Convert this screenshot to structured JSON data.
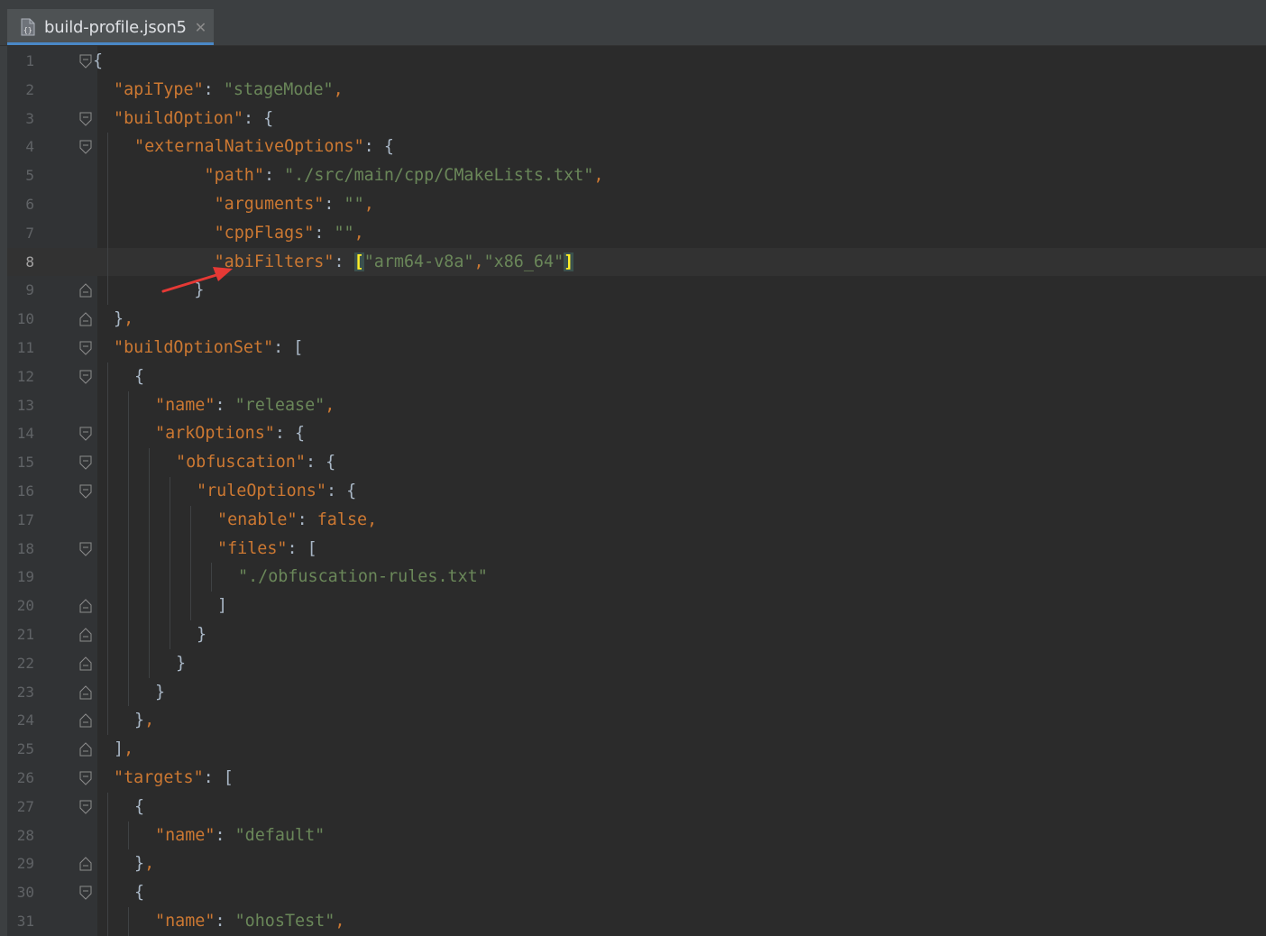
{
  "editor": {
    "tab": {
      "icon": "json-file-icon",
      "name": "build-profile.json5",
      "close_icon": "close-icon"
    }
  },
  "lines": [
    {
      "num": "1",
      "indent": 0,
      "fold": "open",
      "tokens": [
        {
          "t": "{",
          "c": "p"
        }
      ]
    },
    {
      "num": "2",
      "indent": 1,
      "fold": "",
      "tokens": [
        {
          "t": "\"apiType\"",
          "c": "k"
        },
        {
          "t": ": ",
          "c": "p"
        },
        {
          "t": "\"stageMode\"",
          "c": "s"
        },
        {
          "t": ",",
          "c": "o"
        }
      ]
    },
    {
      "num": "3",
      "indent": 1,
      "fold": "open",
      "tokens": [
        {
          "t": "\"buildOption\"",
          "c": "k"
        },
        {
          "t": ": {",
          "c": "p"
        }
      ]
    },
    {
      "num": "4",
      "indent": 2,
      "fold": "open",
      "tokens": [
        {
          "t": "\"externalNativeOptions\"",
          "c": "k"
        },
        {
          "t": ": {",
          "c": "p"
        }
      ]
    },
    {
      "num": "5",
      "indent": 2,
      "fold": "",
      "tokens": [
        {
          "t": "       ",
          "c": "p"
        },
        {
          "t": "\"path\"",
          "c": "k"
        },
        {
          "t": ": ",
          "c": "p"
        },
        {
          "t": "\"./src/main/cpp/CMakeLists.txt\"",
          "c": "s"
        },
        {
          "t": ",",
          "c": "o"
        }
      ]
    },
    {
      "num": "6",
      "indent": 2,
      "fold": "",
      "tokens": [
        {
          "t": "        ",
          "c": "p"
        },
        {
          "t": "\"arguments\"",
          "c": "k"
        },
        {
          "t": ": ",
          "c": "p"
        },
        {
          "t": "\"\"",
          "c": "s"
        },
        {
          "t": ",",
          "c": "o"
        }
      ]
    },
    {
      "num": "7",
      "indent": 2,
      "fold": "",
      "tokens": [
        {
          "t": "        ",
          "c": "p"
        },
        {
          "t": "\"cppFlags\"",
          "c": "k"
        },
        {
          "t": ": ",
          "c": "p"
        },
        {
          "t": "\"\"",
          "c": "s"
        },
        {
          "t": ",",
          "c": "o"
        }
      ]
    },
    {
      "num": "8",
      "indent": 2,
      "fold": "",
      "current": true,
      "tokens": [
        {
          "t": "        ",
          "c": "p"
        },
        {
          "t": "\"abiFilters\"",
          "c": "k"
        },
        {
          "t": ": ",
          "c": "p"
        },
        {
          "t": "[",
          "c": "b"
        },
        {
          "t": "\"arm64-v8a\"",
          "c": "s"
        },
        {
          "t": ",",
          "c": "o"
        },
        {
          "t": "\"x86_64\"",
          "c": "s"
        },
        {
          "t": "]",
          "c": "b"
        }
      ]
    },
    {
      "num": "9",
      "indent": 2,
      "fold": "close",
      "tokens": [
        {
          "t": "      }",
          "c": "p"
        }
      ]
    },
    {
      "num": "10",
      "indent": 1,
      "fold": "close",
      "tokens": [
        {
          "t": "}",
          "c": "p"
        },
        {
          "t": ",",
          "c": "o"
        }
      ]
    },
    {
      "num": "11",
      "indent": 1,
      "fold": "open",
      "tokens": [
        {
          "t": "\"buildOptionSet\"",
          "c": "k"
        },
        {
          "t": ": [",
          "c": "p"
        }
      ]
    },
    {
      "num": "12",
      "indent": 2,
      "fold": "open",
      "tokens": [
        {
          "t": "{",
          "c": "p"
        }
      ]
    },
    {
      "num": "13",
      "indent": 3,
      "fold": "",
      "tokens": [
        {
          "t": "\"name\"",
          "c": "k"
        },
        {
          "t": ": ",
          "c": "p"
        },
        {
          "t": "\"release\"",
          "c": "s"
        },
        {
          "t": ",",
          "c": "o"
        }
      ]
    },
    {
      "num": "14",
      "indent": 3,
      "fold": "open",
      "tokens": [
        {
          "t": "\"arkOptions\"",
          "c": "k"
        },
        {
          "t": ": {",
          "c": "p"
        }
      ]
    },
    {
      "num": "15",
      "indent": 4,
      "fold": "open",
      "tokens": [
        {
          "t": "\"obfuscation\"",
          "c": "k"
        },
        {
          "t": ": {",
          "c": "p"
        }
      ]
    },
    {
      "num": "16",
      "indent": 5,
      "fold": "open",
      "tokens": [
        {
          "t": "\"ruleOptions\"",
          "c": "k"
        },
        {
          "t": ": {",
          "c": "p"
        }
      ]
    },
    {
      "num": "17",
      "indent": 6,
      "fold": "",
      "tokens": [
        {
          "t": "\"enable\"",
          "c": "k"
        },
        {
          "t": ": ",
          "c": "p"
        },
        {
          "t": "false",
          "c": "o"
        },
        {
          "t": ",",
          "c": "o"
        }
      ]
    },
    {
      "num": "18",
      "indent": 6,
      "fold": "open",
      "tokens": [
        {
          "t": "\"files\"",
          "c": "k"
        },
        {
          "t": ": [",
          "c": "p"
        }
      ]
    },
    {
      "num": "19",
      "indent": 7,
      "fold": "",
      "tokens": [
        {
          "t": "\"./obfuscation-rules.txt\"",
          "c": "s"
        }
      ]
    },
    {
      "num": "20",
      "indent": 6,
      "fold": "close",
      "tokens": [
        {
          "t": "]",
          "c": "p"
        }
      ]
    },
    {
      "num": "21",
      "indent": 5,
      "fold": "close",
      "tokens": [
        {
          "t": "}",
          "c": "p"
        }
      ]
    },
    {
      "num": "22",
      "indent": 4,
      "fold": "close",
      "tokens": [
        {
          "t": "}",
          "c": "p"
        }
      ]
    },
    {
      "num": "23",
      "indent": 3,
      "fold": "close",
      "tokens": [
        {
          "t": "}",
          "c": "p"
        }
      ]
    },
    {
      "num": "24",
      "indent": 2,
      "fold": "close",
      "tokens": [
        {
          "t": "}",
          "c": "p"
        },
        {
          "t": ",",
          "c": "o"
        }
      ]
    },
    {
      "num": "25",
      "indent": 1,
      "fold": "close",
      "tokens": [
        {
          "t": "]",
          "c": "p"
        },
        {
          "t": ",",
          "c": "o"
        }
      ]
    },
    {
      "num": "26",
      "indent": 1,
      "fold": "open",
      "tokens": [
        {
          "t": "\"targets\"",
          "c": "k"
        },
        {
          "t": ": [",
          "c": "p"
        }
      ]
    },
    {
      "num": "27",
      "indent": 2,
      "fold": "open",
      "tokens": [
        {
          "t": "{",
          "c": "p"
        }
      ]
    },
    {
      "num": "28",
      "indent": 3,
      "fold": "",
      "tokens": [
        {
          "t": "\"name\"",
          "c": "k"
        },
        {
          "t": ": ",
          "c": "p"
        },
        {
          "t": "\"default\"",
          "c": "s"
        }
      ]
    },
    {
      "num": "29",
      "indent": 2,
      "fold": "close",
      "tokens": [
        {
          "t": "}",
          "c": "p"
        },
        {
          "t": ",",
          "c": "o"
        }
      ]
    },
    {
      "num": "30",
      "indent": 2,
      "fold": "open",
      "tokens": [
        {
          "t": "{",
          "c": "p"
        }
      ]
    },
    {
      "num": "31",
      "indent": 3,
      "fold": "",
      "tokens": [
        {
          "t": "\"name\"",
          "c": "k"
        },
        {
          "t": ": ",
          "c": "p"
        },
        {
          "t": "\"ohosTest\"",
          "c": "s"
        },
        {
          "t": ",",
          "c": "o"
        }
      ]
    }
  ],
  "colors": {
    "background": "#2b2b2b",
    "gutter": "#313335",
    "key": "#cc7832",
    "string": "#6a8759",
    "punct": "#a9b7c6",
    "orange": "#cc7832",
    "bracket_highlight": "#ffef28",
    "current_line": "#323232",
    "tab_underline": "#4a88c7",
    "annotation_arrow": "#e53935"
  }
}
